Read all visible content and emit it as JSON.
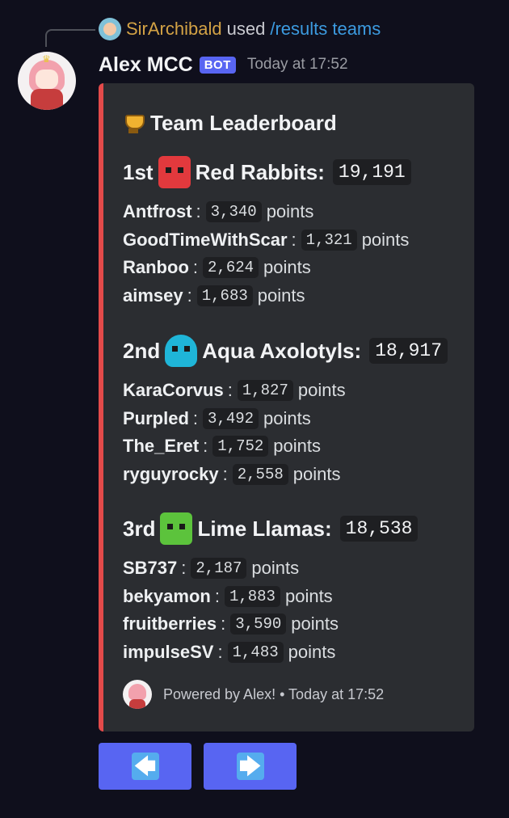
{
  "reply": {
    "user": "SirArchibald",
    "verb": "used",
    "command": "/results teams"
  },
  "message": {
    "author": "Alex MCC",
    "badge": "BOT",
    "timestamp": "Today at 17:52"
  },
  "embed": {
    "title": "Team Leaderboard",
    "accent_color": "#e34a4a",
    "teams": [
      {
        "rank": "1st",
        "name": "Red Rabbits:",
        "total": "19,191",
        "icon": "red-rabbit-icon",
        "members": [
          {
            "name": "Antfrost",
            "points": "3,340",
            "unit": "points"
          },
          {
            "name": "GoodTimeWithScar",
            "points": "1,321",
            "unit": "points"
          },
          {
            "name": "Ranboo",
            "points": "2,624",
            "unit": "points"
          },
          {
            "name": "aimsey",
            "points": "1,683",
            "unit": "points"
          }
        ]
      },
      {
        "rank": "2nd",
        "name": "Aqua Axolotyls:",
        "total": "18,917",
        "icon": "aqua-axolotl-icon",
        "members": [
          {
            "name": "KaraCorvus",
            "points": "1,827",
            "unit": "points"
          },
          {
            "name": "Purpled",
            "points": "3,492",
            "unit": "points"
          },
          {
            "name": "The_Eret",
            "points": "1,752",
            "unit": "points"
          },
          {
            "name": "ryguyrocky",
            "points": "2,558",
            "unit": "points"
          }
        ]
      },
      {
        "rank": "3rd",
        "name": "Lime Llamas:",
        "total": "18,538",
        "icon": "lime-llama-icon",
        "members": [
          {
            "name": "SB737",
            "points": "2,187",
            "unit": "points"
          },
          {
            "name": "bekyamon",
            "points": "1,883",
            "unit": "points"
          },
          {
            "name": "fruitberries",
            "points": "3,590",
            "unit": "points"
          },
          {
            "name": "impulseSV",
            "points": "1,483",
            "unit": "points"
          }
        ]
      }
    ],
    "footer": "Powered by Alex! • Today at 17:52"
  },
  "buttons": {
    "prev": "🡄",
    "next": "🡆",
    "color": "#5865f2"
  }
}
